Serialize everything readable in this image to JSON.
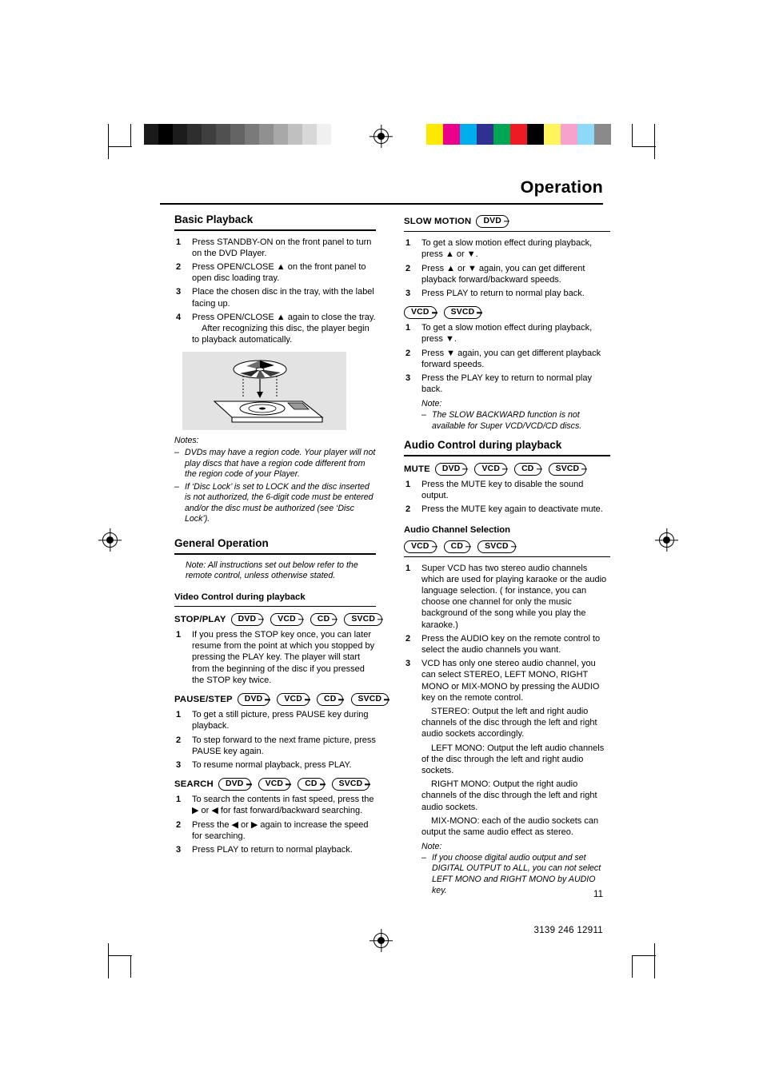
{
  "header": {
    "title": "Operation"
  },
  "footer": {
    "page_number": "11",
    "doc_code": "3139 246 12911"
  },
  "badges": {
    "dvd": "DVD",
    "vcd": "VCD",
    "cd": "CD",
    "svcd": "SVCD"
  },
  "left_column": {
    "basic_playback": {
      "title": "Basic Playback",
      "steps": [
        "Press STANDBY-ON on the front panel to turn on the DVD Player.",
        "Press OPEN/CLOSE ▲ on the front panel to open disc loading tray.",
        "Place the chosen disc in the tray, with the label facing up.",
        "Press OPEN/CLOSE ▲ again to close the tray."
      ],
      "step4_extra": "After recognizing this disc, the player begin to playback automatically.",
      "notes_label": "Notes:",
      "notes": [
        "DVDs may have a region code. Your player will not play discs that have a region code different from the region code of  your Player.",
        "If ‘Disc Lock’ is set to LOCK and the disc inserted is not authorized, the 6-digit code must be entered and/or the disc must be authorized (see ‘Disc Lock’)."
      ]
    },
    "general_operation": {
      "title": "General Operation",
      "note": "Note:  All instructions set out below refer to the remote control, unless otherwise stated."
    },
    "video_control": {
      "title": "Video Control during playback",
      "stop_play": {
        "label": "STOP/PLAY",
        "steps": [
          "If you press the STOP key once, you can later resume from the point at which you stopped by pressing the PLAY key. The player will start from the beginning of the disc if you pressed the STOP key twice."
        ]
      },
      "pause_step": {
        "label": "PAUSE/STEP",
        "steps": [
          "To get a still picture, press PAUSE key during playback.",
          "To step forward to the next frame picture, press PAUSE key again.",
          "To resume normal playback, press PLAY."
        ]
      },
      "search": {
        "label": "SEARCH",
        "steps": [
          "To search the contents in fast speed, press the ▶ or ◀ for fast forward/backward searching.",
          "Press the ◀ or ▶ again to increase the speed for searching.",
          "Press PLAY to return to normal playback."
        ]
      }
    }
  },
  "right_column": {
    "slow_motion": {
      "label": "SLOW MOTION",
      "dvd_steps": [
        "To get a slow motion effect during playback, press ▲ or ▼.",
        "Press ▲ or ▼ again, you can get different playback forward/backward speeds.",
        "Press PLAY to return to normal play back."
      ],
      "vcd_steps": [
        "To get a slow motion effect during playback, press ▼.",
        "Press ▼ again, you can get different playback forward speeds.",
        "Press the PLAY key to return to normal play back."
      ],
      "note_label": "Note:",
      "note": "The SLOW BACKWARD function is not available for Super VCD/VCD/CD discs."
    },
    "audio_control": {
      "title": "Audio Control during playback",
      "mute": {
        "label": "MUTE",
        "steps": [
          "Press the MUTE key to disable the sound output.",
          "Press the MUTE key again to deactivate mute."
        ]
      },
      "audio_channel": {
        "title": "Audio Channel Selection",
        "steps": [
          "Super VCD has two stereo audio channels which are used for playing karaoke or the audio language selection. ( for instance, you can choose one channel for only the music background of the song while you play the karaoke.)",
          "Press the AUDIO key on the remote control to select the audio channels you want.",
          "VCD has only one stereo audio channel, you can select STEREO, LEFT MONO, RIGHT MONO or MIX-MONO by pressing the AUDIO key on the remote control."
        ],
        "step3_details": [
          "STEREO: Output the left and right audio channels of the disc through the left and right audio sockets accordingly.",
          "LEFT MONO: Output the left audio channels of the disc through the left and right audio sockets.",
          "RIGHT MONO: Output the right audio channels of the disc through the left and right audio sockets.",
          "MIX-MONO: each of the audio sockets can output the same audio effect as stereo."
        ],
        "note_label": "Note:",
        "note": "If you choose digital audio output and set DIGITAL OUTPUT to ALL, you can not select LEFT MONO and RIGHT MONO by AUDIO key."
      }
    }
  },
  "color_bars": {
    "grayscale": [
      "#1a1a1a",
      "#000000",
      "#1c1c1c",
      "#2e2e2e",
      "#3f3f3f",
      "#505050",
      "#646464",
      "#7a7a7a",
      "#909090",
      "#a8a8a8",
      "#c0c0c0",
      "#d8d8d8",
      "#f0f0f0",
      "#ffffff"
    ],
    "colors": [
      "#ffe800",
      "#ec008c",
      "#00aeef",
      "#2e3192",
      "#00a651",
      "#ed1c24",
      "#000000",
      "#fff45c",
      "#f7a1cd",
      "#8ed8f8",
      "#8a8a8a"
    ]
  }
}
